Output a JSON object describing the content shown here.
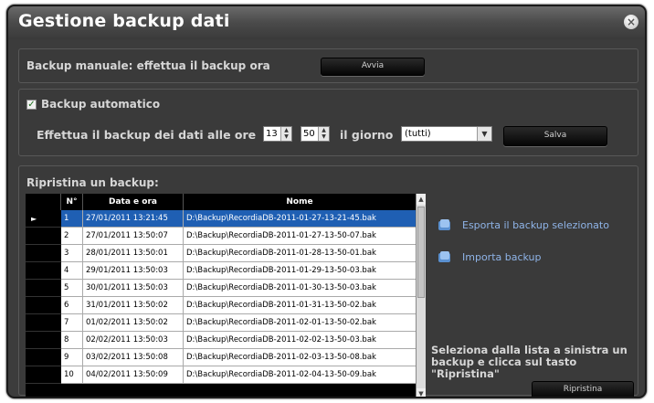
{
  "window": {
    "title": "Gestione backup dati",
    "close_icon": "close-icon"
  },
  "manual": {
    "label": "Backup manuale: effettua il backup ora",
    "button": "Avvia"
  },
  "auto": {
    "checkbox_label": "Backup automatico",
    "checked": true,
    "sentence_prefix": "Effettua il backup dei dati alle ore",
    "hour": "13",
    "minute": "50",
    "day_label": "il giorno",
    "day_value": "(tutti)",
    "save_button": "Salva"
  },
  "restore": {
    "title": "Ripristina un backup:",
    "columns": [
      "N°",
      "Data e ora",
      "Nome"
    ],
    "rows": [
      {
        "n": "1",
        "date": "27/01/2011 13:21:45",
        "name": "D:\\Backup\\RecordiaDB-2011-01-27-13-21-45.bak"
      },
      {
        "n": "2",
        "date": "27/01/2011 13:50:07",
        "name": "D:\\Backup\\RecordiaDB-2011-01-27-13-50-07.bak"
      },
      {
        "n": "3",
        "date": "28/01/2011 13:50:01",
        "name": "D:\\Backup\\RecordiaDB-2011-01-28-13-50-01.bak"
      },
      {
        "n": "4",
        "date": "29/01/2011 13:50:03",
        "name": "D:\\Backup\\RecordiaDB-2011-01-29-13-50-03.bak"
      },
      {
        "n": "5",
        "date": "30/01/2011 13:50:03",
        "name": "D:\\Backup\\RecordiaDB-2011-01-30-13-50-03.bak"
      },
      {
        "n": "6",
        "date": "31/01/2011 13:50:02",
        "name": "D:\\Backup\\RecordiaDB-2011-01-31-13-50-02.bak"
      },
      {
        "n": "7",
        "date": "01/02/2011 13:50:02",
        "name": "D:\\Backup\\RecordiaDB-2011-02-01-13-50-02.bak"
      },
      {
        "n": "8",
        "date": "02/02/2011 13:50:03",
        "name": "D:\\Backup\\RecordiaDB-2011-02-02-13-50-03.bak"
      },
      {
        "n": "9",
        "date": "03/02/2011 13:50:08",
        "name": "D:\\Backup\\RecordiaDB-2011-02-03-13-50-08.bak"
      },
      {
        "n": "10",
        "date": "04/02/2011 13:50:09",
        "name": "D:\\Backup\\RecordiaDB-2011-02-04-13-50-09.bak"
      }
    ],
    "selected_row": 0,
    "export_action": "Esporta il backup selezionato",
    "import_action": "Importa backup",
    "instructions": "Seleziona dalla lista a sinistra un backup e clicca sul tasto \"Ripristina\"",
    "restore_button": "Ripristina"
  },
  "colors": {
    "selected_row": "#1f5fb3",
    "link": "#8fb4e8",
    "panel": "#3a3a3a"
  }
}
